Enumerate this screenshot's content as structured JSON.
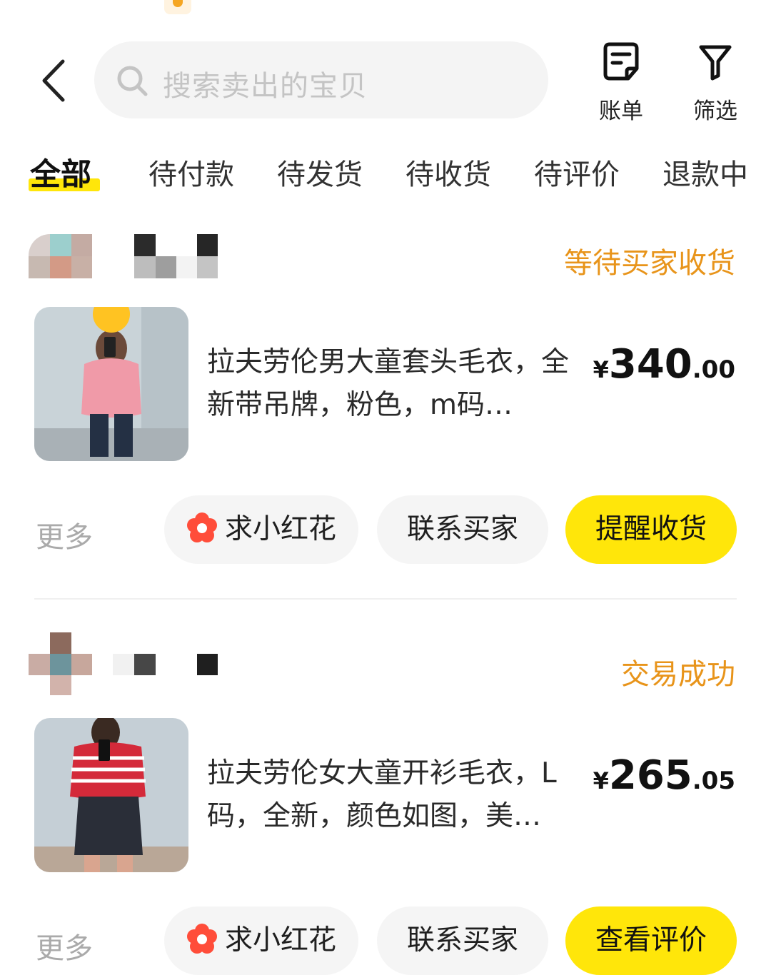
{
  "header": {
    "search_placeholder": "搜索卖出的宝贝",
    "bill_label": "账单",
    "filter_label": "筛选"
  },
  "tabs": [
    {
      "label": "全部",
      "active": true
    },
    {
      "label": "待付款",
      "active": false
    },
    {
      "label": "待发货",
      "active": false
    },
    {
      "label": "待收货",
      "active": false
    },
    {
      "label": "待评价",
      "active": false
    },
    {
      "label": "退款中",
      "active": false
    }
  ],
  "orders": [
    {
      "status": "等待买家收货",
      "title": "拉夫劳伦男大童套头毛衣，全新带吊牌，粉色，m码…",
      "price": {
        "currency": "¥",
        "integer": "340",
        "decimal": ".00"
      },
      "more_label": "更多",
      "flower_label": "求小红花",
      "contact_label": "联系买家",
      "primary_label": "提醒收货"
    },
    {
      "status": "交易成功",
      "title": "拉夫劳伦女大童开衫毛衣，L码，全新，颜色如图，美…",
      "price": {
        "currency": "¥",
        "integer": "265",
        "decimal": ".05"
      },
      "more_label": "更多",
      "flower_label": "求小红花",
      "contact_label": "联系买家",
      "primary_label": "查看评价"
    }
  ],
  "colors": {
    "accent_yellow": "#ffe60a",
    "status_orange": "#e8941a",
    "flower_red": "#ff4d3a"
  }
}
